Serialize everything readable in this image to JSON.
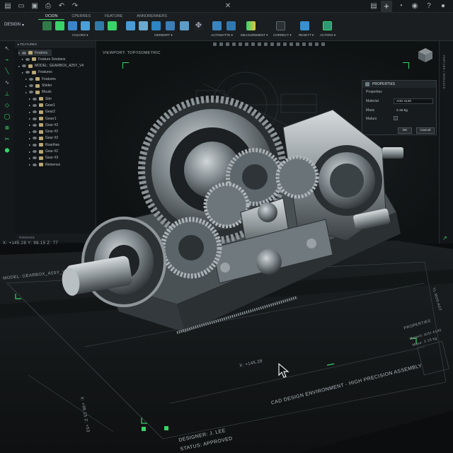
{
  "ribbon": {
    "tabs": [
      "DCIDN",
      "CPERRES",
      "FEATURE",
      "ANNORENNERS"
    ],
    "design_label": "DESIGN",
    "groups": [
      "COLORS",
      "GERBORT",
      "AUTOMATTE",
      "MEASUREMENT",
      "CORRECT",
      "RESETT",
      "ACTORS"
    ]
  },
  "browser": {
    "header": "FEATURES",
    "rows": [
      {
        "label": "Featons",
        "indent": 0,
        "selected": true
      },
      {
        "label": "Feature Sroolans",
        "indent": 1
      },
      {
        "label": "MODEL: GEARBOX_A25Y_V4",
        "indent": 0
      },
      {
        "label": "Features",
        "indent": 1
      },
      {
        "label": "Features",
        "indent": 2
      },
      {
        "label": "Shider",
        "indent": 2
      },
      {
        "label": "Mouts",
        "indent": 2
      },
      {
        "label": "Stirr",
        "indent": 3
      },
      {
        "label": "Gear1",
        "indent": 3
      },
      {
        "label": "Gear2",
        "indent": 3
      },
      {
        "label": "Gearr1",
        "indent": 3
      },
      {
        "label": "Gear #3",
        "indent": 3
      },
      {
        "label": "Gear #2",
        "indent": 3
      },
      {
        "label": "Gear #2",
        "indent": 3
      },
      {
        "label": "Roarihes",
        "indent": 3
      },
      {
        "label": "Gear #2",
        "indent": 3
      },
      {
        "label": "Gear #3",
        "indent": 3
      },
      {
        "label": "Retxence",
        "indent": 3
      }
    ],
    "footer": "RXDNAES"
  },
  "right_panel_label": "PARTURE / SERIANCE",
  "viewport": {
    "label": "VIEWPORT: TOP/ISOMETRIC"
  },
  "properties": {
    "title": "PROPERTIES",
    "section": "Properties",
    "material_label": "Material",
    "material_value": "AISI 4140",
    "mass_label": "Mass",
    "mass_value": "2.15 kg",
    "maturs_label": "Maturs",
    "ok_label": "OK",
    "cancel_label": "Cancel"
  },
  "table": {
    "coord_readout": "X: +145.28   Y: 98.15 Z: 77",
    "model_label": "MODEL: GEARBOX_A5SY_V4",
    "x_readout": "X: +145.28",
    "side_readout": "X: +98.15 Z: +53",
    "env_label": "CAD DESIGN ENVIRONMENT - HIGH PRECISION ASSEMBLY",
    "designer": "DESIGNER: J. LEE",
    "status": "STATUS: APPROVED",
    "props_card_title": "PROPERTIES",
    "props_card_material": "Materil: AISI 4140",
    "props_card_mass": "Mass: 2.15 kg",
    "props_card_code": "YL MOS AGT"
  },
  "colors": {
    "accent": "#39d36a",
    "background": "#0b0d0e",
    "panel": "#121517"
  }
}
